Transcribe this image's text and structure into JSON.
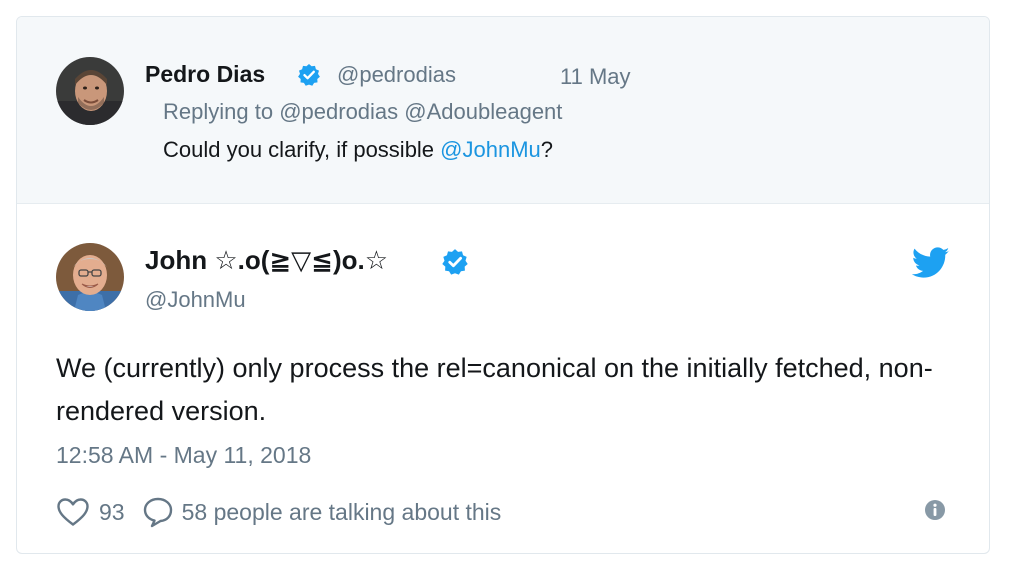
{
  "parent_tweet": {
    "name": "Pedro Dias",
    "handle": "@pedrodias",
    "date": "11 May",
    "reply_prefix": "Replying to",
    "reply_to": "@pedrodias @Adoubleagent",
    "text": "Could you clarify, if possible ",
    "mention": "@JohnMu",
    "text_end": "?"
  },
  "main_tweet": {
    "name": "John ☆.o(≧▽≦)o.☆",
    "handle": "@JohnMu",
    "text": "We (currently) only process the rel=canonical on the initially fetched, non-rendered version.",
    "timestamp": "12:58 AM - May 11, 2018",
    "likes": "93",
    "talking": "58 people are talking about this"
  },
  "colors": {
    "accent": "#1da1f2",
    "verified": "#1da1f2",
    "mention": "#1b95e0",
    "secondary_text": "#657786",
    "parent_bg": "#f5f8fa"
  },
  "icons": [
    "verified-badge-icon",
    "twitter-bird-icon",
    "heart-icon",
    "speech-bubble-icon",
    "info-icon"
  ]
}
